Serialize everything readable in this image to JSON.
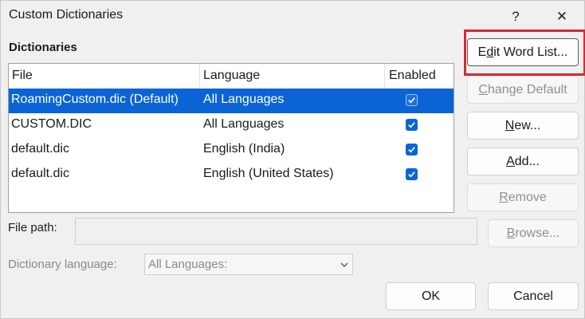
{
  "window": {
    "title": "Custom Dictionaries",
    "help_glyph": "?",
    "close_glyph": "✕"
  },
  "dictionaries": {
    "group_label": "Dictionaries",
    "columns": {
      "file": "File",
      "language": "Language",
      "enabled": "Enabled"
    },
    "rows": [
      {
        "file": "RoamingCustom.dic (Default)",
        "language": "All Languages",
        "enabled": true,
        "selected": true
      },
      {
        "file": "CUSTOM.DIC",
        "language": "All Languages",
        "enabled": true,
        "selected": false
      },
      {
        "file": "default.dic",
        "language": "English (India)",
        "enabled": true,
        "selected": false
      },
      {
        "file": "default.dic",
        "language": "English (United States)",
        "enabled": true,
        "selected": false
      }
    ]
  },
  "file_path": {
    "label": "File path:",
    "value": ""
  },
  "browse_button": {
    "label_underlined": "B",
    "label_rest": "rowse..."
  },
  "dictionary_language": {
    "label": "Dictionary language:",
    "selected": "All Languages:"
  },
  "buttons": {
    "edit_word_list": {
      "pre": "E",
      "underlined": "d",
      "post": "it Word List..."
    },
    "change_default": {
      "underlined": "C",
      "post": "hange Default"
    },
    "new": {
      "underlined": "N",
      "post": "ew..."
    },
    "add": {
      "underlined": "A",
      "post": "dd..."
    },
    "remove": {
      "underlined": "R",
      "post": "emove"
    },
    "ok": "OK",
    "cancel": "Cancel"
  },
  "colors": {
    "selection": "#0a64d6",
    "highlight_box": "#d42a35"
  }
}
